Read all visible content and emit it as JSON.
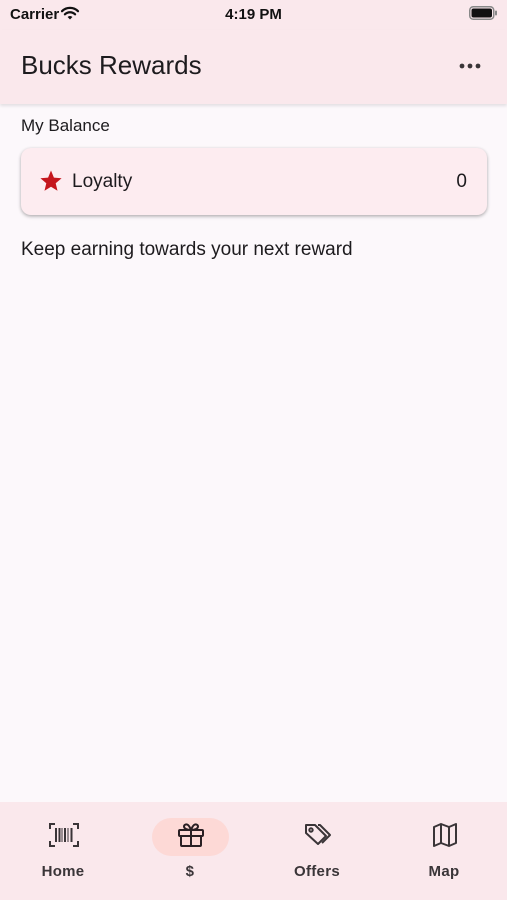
{
  "status_bar": {
    "carrier": "Carrier",
    "time": "4:19 PM"
  },
  "app_bar": {
    "title": "Bucks Rewards",
    "more_icon": "more-horiz-icon"
  },
  "balance": {
    "section_label": "My Balance",
    "card": {
      "icon": "star-icon",
      "label": "Loyalty",
      "value": "0"
    }
  },
  "message": "Keep earning towards your next reward",
  "bottom_nav": {
    "items": [
      {
        "label": "Home",
        "icon": "barcode-icon",
        "active": false
      },
      {
        "label": "$",
        "icon": "gift-icon",
        "active": true
      },
      {
        "label": "Offers",
        "icon": "tags-icon",
        "active": false
      },
      {
        "label": "Map",
        "icon": "map-icon",
        "active": false
      }
    ]
  },
  "colors": {
    "accent": "#c5161d",
    "surface": "#fae8ec",
    "active_pill": "#fdd9d6"
  }
}
